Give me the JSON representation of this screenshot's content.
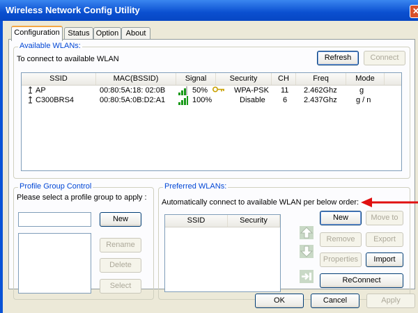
{
  "window": {
    "title": "Wireless Network Config Utility",
    "close_glyph": "✕"
  },
  "tabs": [
    {
      "label": "Configuration",
      "active": true
    },
    {
      "label": "Status"
    },
    {
      "label": "Option"
    },
    {
      "label": "About"
    }
  ],
  "available": {
    "legend": "Available WLANs:",
    "instruction": "To connect to available WLAN",
    "refresh_label": "Refresh",
    "connect_label": "Connect",
    "columns": [
      "SSID",
      "MAC(BSSID)",
      "Signal",
      "Security",
      "CH",
      "Freq",
      "Mode"
    ],
    "rows": [
      {
        "ssid": "AP",
        "mac": "00:80:5A:18: 02:0B",
        "signal": "50%",
        "signal_level": 0.5,
        "security": "WPA-PSK",
        "secured": true,
        "ch": "11",
        "freq": "2.462Ghz",
        "mode": "g"
      },
      {
        "ssid": "C300BRS4",
        "mac": "00:80:5A:0B:D2:A1",
        "signal": "100%",
        "signal_level": 1.0,
        "security": "Disable",
        "secured": false,
        "ch": "6",
        "freq": "2.437Ghz",
        "mode": "g / n"
      }
    ]
  },
  "profile": {
    "legend": "Profile Group Control",
    "instruction": "Please select a profile group to apply :",
    "new_label": "New",
    "rename_label": "Rename",
    "delete_label": "Delete",
    "select_label": "Select"
  },
  "preferred": {
    "legend": "Preferred WLANs:",
    "instruction": "Automatically connect to available WLAN per below order:",
    "columns": [
      "SSID",
      "Security"
    ],
    "new_label": "New",
    "move_label": "Move to",
    "remove_label": "Remove",
    "export_label": "Export",
    "properties_label": "Properties",
    "import_label": "Import",
    "reconnect_label": "ReConnect"
  },
  "footer": {
    "ok_label": "OK",
    "cancel_label": "Cancel",
    "apply_label": "Apply"
  },
  "colors": {
    "accent": "#0046d5",
    "annotation_arrow": "#e01010",
    "signal_green": "#1a9a1a"
  }
}
